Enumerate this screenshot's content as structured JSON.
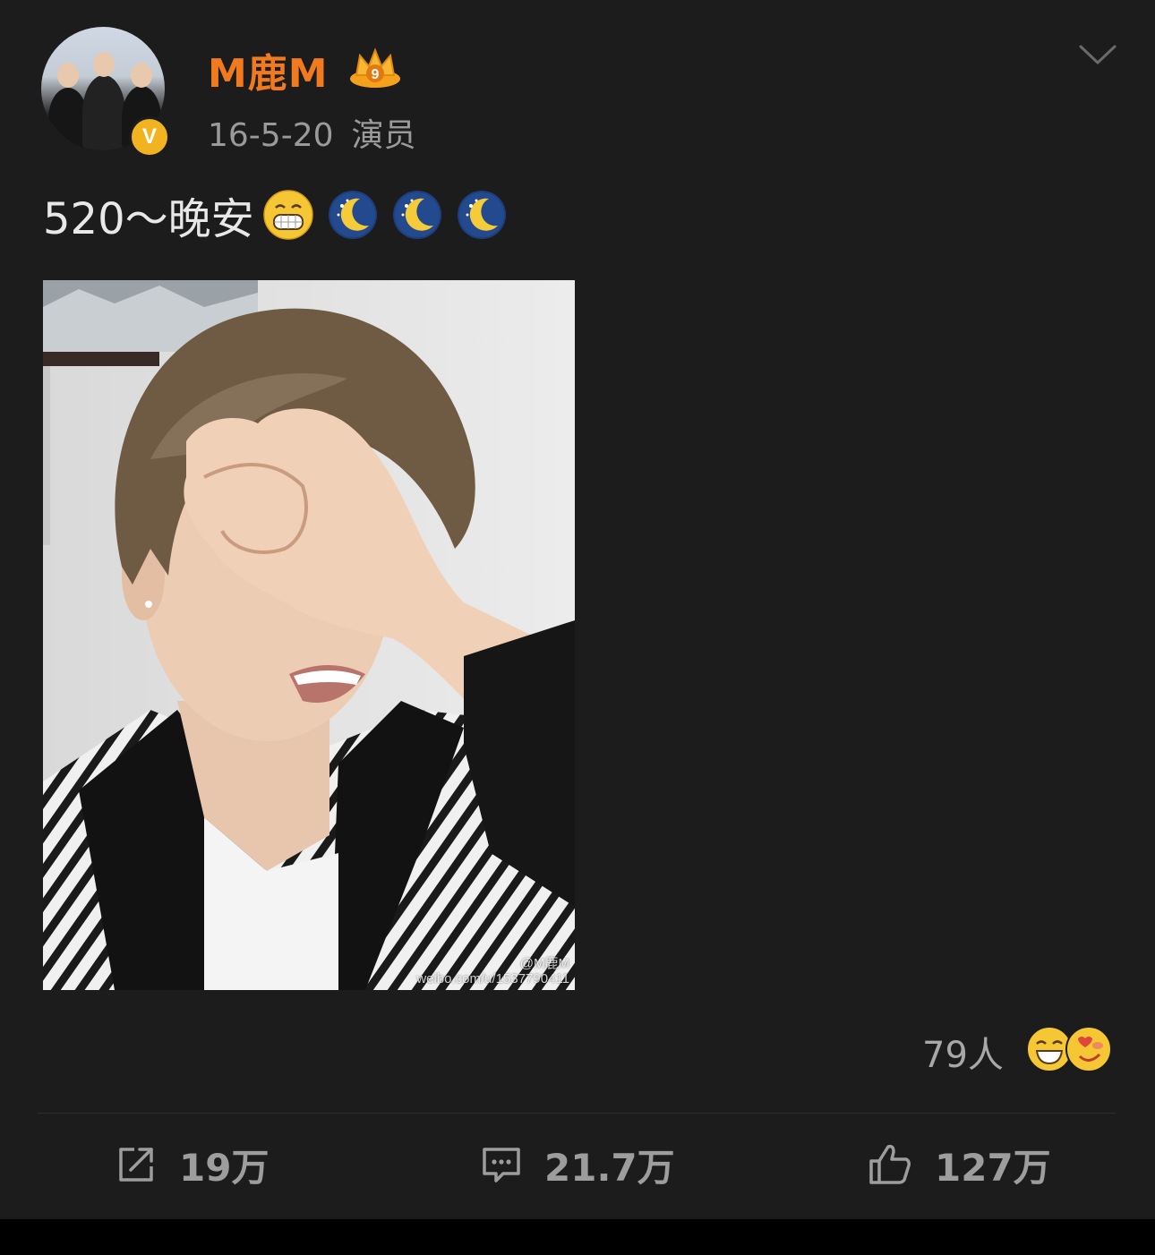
{
  "user": {
    "name": "M鹿M",
    "date": "16-5-20",
    "tag": "演员",
    "verified_mark": "V",
    "badge_icon": "crown-level-badge"
  },
  "post": {
    "text": "520～晚安",
    "emojis": [
      "grin-emoji",
      "moon-emoji",
      "moon-emoji",
      "moon-emoji"
    ],
    "image_watermark_handle": "@M鹿M",
    "image_watermark_url": "weibo.com/u/1537790411"
  },
  "reactions": {
    "count_label": "79人",
    "icons": [
      "laugh-emoji",
      "love-emoji"
    ]
  },
  "actions": {
    "repost_count": "19万",
    "comment_count": "21.7万",
    "like_count": "127万"
  },
  "colors": {
    "background": "#1c1c1c",
    "username": "#f07a1d",
    "meta": "#9a9a9a",
    "verified": "#f2b321"
  }
}
